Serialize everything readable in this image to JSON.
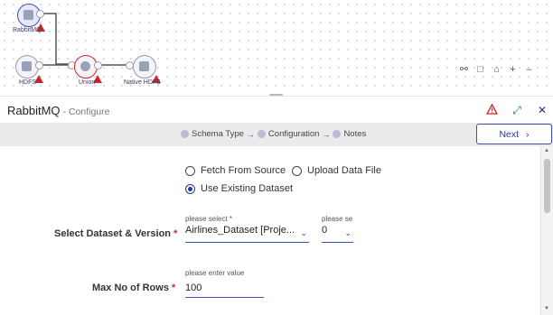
{
  "pipeline": {
    "nodes": {
      "rabbitmq": "RabbitMQ",
      "hdfs": "HDFS",
      "union": "Union",
      "native_hdfs": "Native HDFS"
    },
    "tools": [
      "share-nodes-icon",
      "select-box-icon",
      "home-icon",
      "zoom-in-icon",
      "zoom-out-icon"
    ]
  },
  "header": {
    "title": "RabbitMQ",
    "subtitle": "- Configure"
  },
  "steps": {
    "step1": "Schema Type",
    "arrow": "→",
    "step2": "Configuration",
    "step3": "Notes",
    "next": "Next"
  },
  "form": {
    "source_options": {
      "fetch": "Fetch From Source",
      "upload": "Upload Data File",
      "existing": "Use Existing Dataset",
      "selected": "Use Existing Dataset"
    },
    "dataset": {
      "label": "Select Dataset & Version",
      "required": "*",
      "dataset_hint": "please select *",
      "dataset_value": "Airlines_Dataset [Proje...",
      "version_hint": "please se",
      "version_value": "0"
    },
    "rows": {
      "label": "Max No of Rows",
      "required": "*",
      "hint": "please enter value",
      "value": "100"
    }
  },
  "colors": {
    "primary": "#283593",
    "error": "#c62828",
    "steps_bg": "#ebebeb"
  }
}
